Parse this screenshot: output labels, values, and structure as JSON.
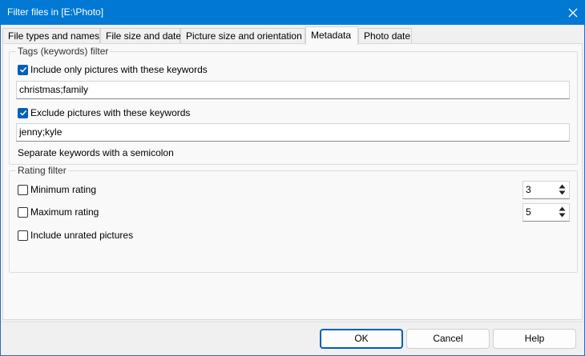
{
  "window": {
    "title": "Filter files in [E:\\Photo]"
  },
  "tabs": [
    {
      "label": "File types and names"
    },
    {
      "label": "File size and date"
    },
    {
      "label": "Picture size and orientation"
    },
    {
      "label": "Metadata"
    },
    {
      "label": "Photo date"
    }
  ],
  "active_tab": "Metadata",
  "tags_group": {
    "title": "Tags (keywords) filter",
    "include_label": "Include only pictures with these keywords",
    "include_checked": true,
    "include_value": "christmas;family",
    "exclude_label": "Exclude pictures with these keywords",
    "exclude_checked": true,
    "exclude_value": "jenny;kyle",
    "hint": "Separate keywords with a semicolon"
  },
  "rating_group": {
    "title": "Rating filter",
    "min_label": "Minimum rating",
    "min_checked": false,
    "min_value": "3",
    "max_label": "Maximum rating",
    "max_checked": false,
    "max_value": "5",
    "unrated_label": "Include unrated pictures",
    "unrated_checked": false
  },
  "buttons": {
    "ok": "OK",
    "cancel": "Cancel",
    "help": "Help"
  },
  "colors": {
    "accent": "#0078d4",
    "checkbox": "#005fb8"
  },
  "icons": [
    "close-icon",
    "checkmark-icon",
    "spin-up-icon",
    "spin-down-icon"
  ]
}
